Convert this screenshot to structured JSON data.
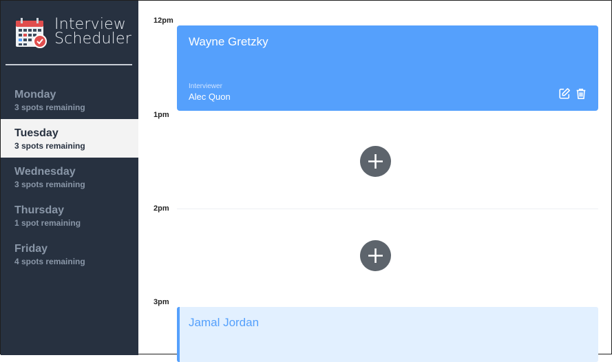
{
  "app": {
    "title_line1": "Interview",
    "title_line2": "Scheduler"
  },
  "days": [
    {
      "name": "Monday",
      "spots": "3 spots remaining",
      "selected": false
    },
    {
      "name": "Tuesday",
      "spots": "3 spots remaining",
      "selected": true
    },
    {
      "name": "Wednesday",
      "spots": "3 spots remaining",
      "selected": false
    },
    {
      "name": "Thursday",
      "spots": "1 spot remaining",
      "selected": false
    },
    {
      "name": "Friday",
      "spots": "4 spots remaining",
      "selected": false
    }
  ],
  "times": [
    "12pm",
    "1pm",
    "2pm",
    "3pm"
  ],
  "appointments": {
    "first": {
      "student": "Wayne Gretzky",
      "interviewer_label": "Interviewer",
      "interviewer": "Alec Quon"
    },
    "last": {
      "student": "Jamal Jordan"
    }
  },
  "colors": {
    "sidebar": "#273140",
    "accent": "#55a0fc",
    "add_button": "#5d646c"
  },
  "icons": {
    "logo": "calendar-icon",
    "edit": "edit-icon",
    "delete": "trash-icon",
    "add": "plus-icon"
  }
}
